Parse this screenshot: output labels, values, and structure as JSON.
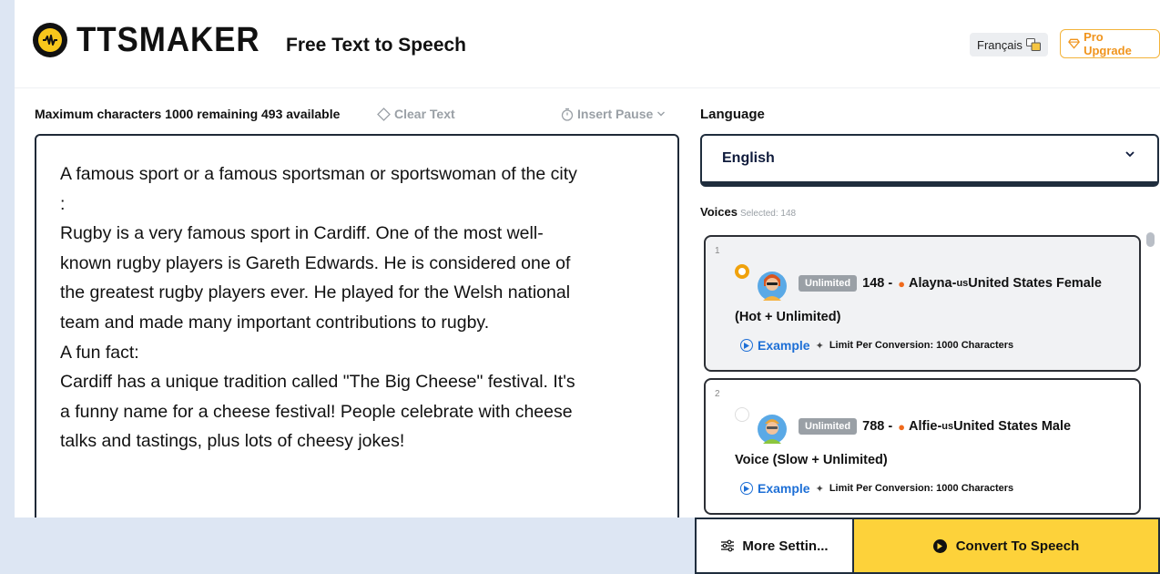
{
  "header": {
    "logo_text": "TTSMAKER",
    "tagline": "Free Text to Speech",
    "language_button": "Français",
    "pro_upgrade": "Pro Upgrade"
  },
  "toolbar": {
    "max_chars": "Maximum characters 1000 remaining 493 available",
    "clear_text": "Clear Text",
    "insert_pause": "Insert Pause"
  },
  "editor": {
    "text": "A famous sport or a famous sportsman or sportswoman of the city\n:\nRugby is a very famous sport in Cardiff. One of the most well-\nknown rugby players is Gareth Edwards. He is considered one of\nthe greatest rugby players ever. He played for the Welsh national\nteam and made many important contributions to rugby.\nA fun fact:\nCardiff has a unique tradition called \"The Big Cheese\" festival. It's\na funny name for a cheese festival! People celebrate with cheese\ntalks and tastings, plus lots of cheesy jokes!"
  },
  "language": {
    "label": "Language",
    "selected": "English"
  },
  "voices": {
    "label": "Voices",
    "selected_text": "Selected: 148",
    "items": [
      {
        "index": "1",
        "badge": "Unlimited",
        "id": "148 -",
        "name": "Alayna-",
        "region_code": "us",
        "name_rest": "United States Female",
        "line2": "(Hot + Unlimited)",
        "example": "Example",
        "limit": "Limit Per Conversion: 1000 Characters",
        "selected": true
      },
      {
        "index": "2",
        "badge": "Unlimited",
        "id": "788 -",
        "name": "Alfie-",
        "region_code": "us",
        "name_rest": " United States Male",
        "line2": "Voice (Slow + Unlimited)",
        "example": "Example",
        "limit": "Limit Per Conversion: 1000 Characters",
        "selected": false
      }
    ]
  },
  "actions": {
    "more_settings": "More Settin...",
    "convert": "Convert To Speech"
  },
  "colors": {
    "accent": "#fdd23a",
    "link": "#1d6fd6",
    "badge": "#9aa0a6",
    "page_bg": "#dde6f3"
  }
}
